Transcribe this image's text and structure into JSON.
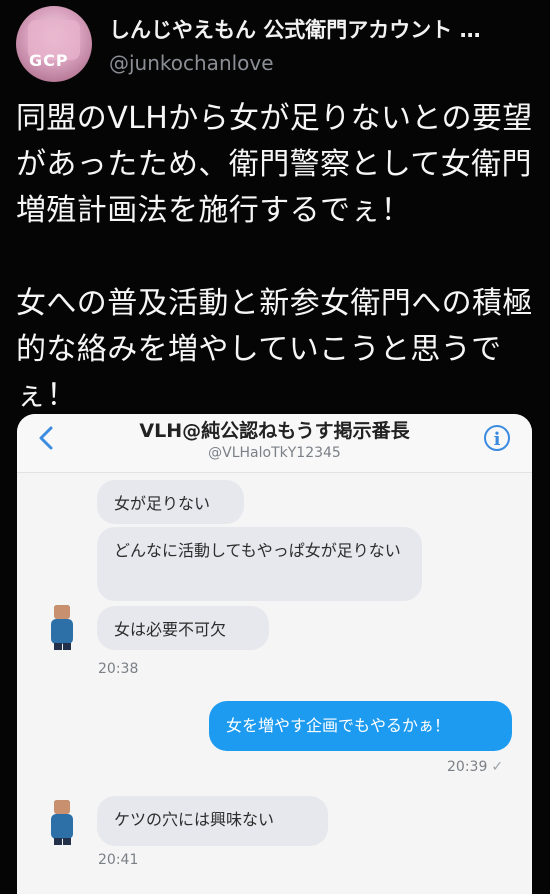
{
  "tweet": {
    "display_name": "しんじやえもん 公式衛門アカウント …",
    "handle": "@junkochanlove",
    "body": {
      "paragraph1": "同盟のVLHから女が足りないとの要望があったため、衛門警察として女衛門増殖計画法を施行するでぇ！",
      "paragraph2": "女への普及活動と新参女衛門への積極的な絡みを増やしていこうと思うでぇ！"
    },
    "avatar": {
      "label": "GCP"
    }
  },
  "dm_screenshot": {
    "header": {
      "title": "VLH@純公認ねもうす掲示番長",
      "subtitle": "@VLHaloTkY12345",
      "back_icon": "chevron-left-icon",
      "info_icon": "info-icon"
    },
    "messages": [
      {
        "text": "女が足りない",
        "direction": "incoming"
      },
      {
        "text": "どんなに活動してもやっぱ女が足りない",
        "direction": "incoming"
      },
      {
        "text": "女は必要不可欠",
        "direction": "incoming"
      },
      {
        "text": "20:38",
        "direction": "timestamp-incoming"
      },
      {
        "text": "女を増やす企画でもやるかぁ！",
        "direction": "outgoing"
      },
      {
        "text": "20:39",
        "direction": "timestamp-outgoing"
      },
      {
        "text": "ケツの穴には興味ない",
        "direction": "incoming"
      },
      {
        "text": "20:41",
        "direction": "timestamp-incoming"
      }
    ]
  },
  "colors": {
    "background": "#050505",
    "outgoing_bubble": "#1d9bf0",
    "incoming_bubble": "#e6e8ee",
    "accent": "#3b8be0"
  }
}
